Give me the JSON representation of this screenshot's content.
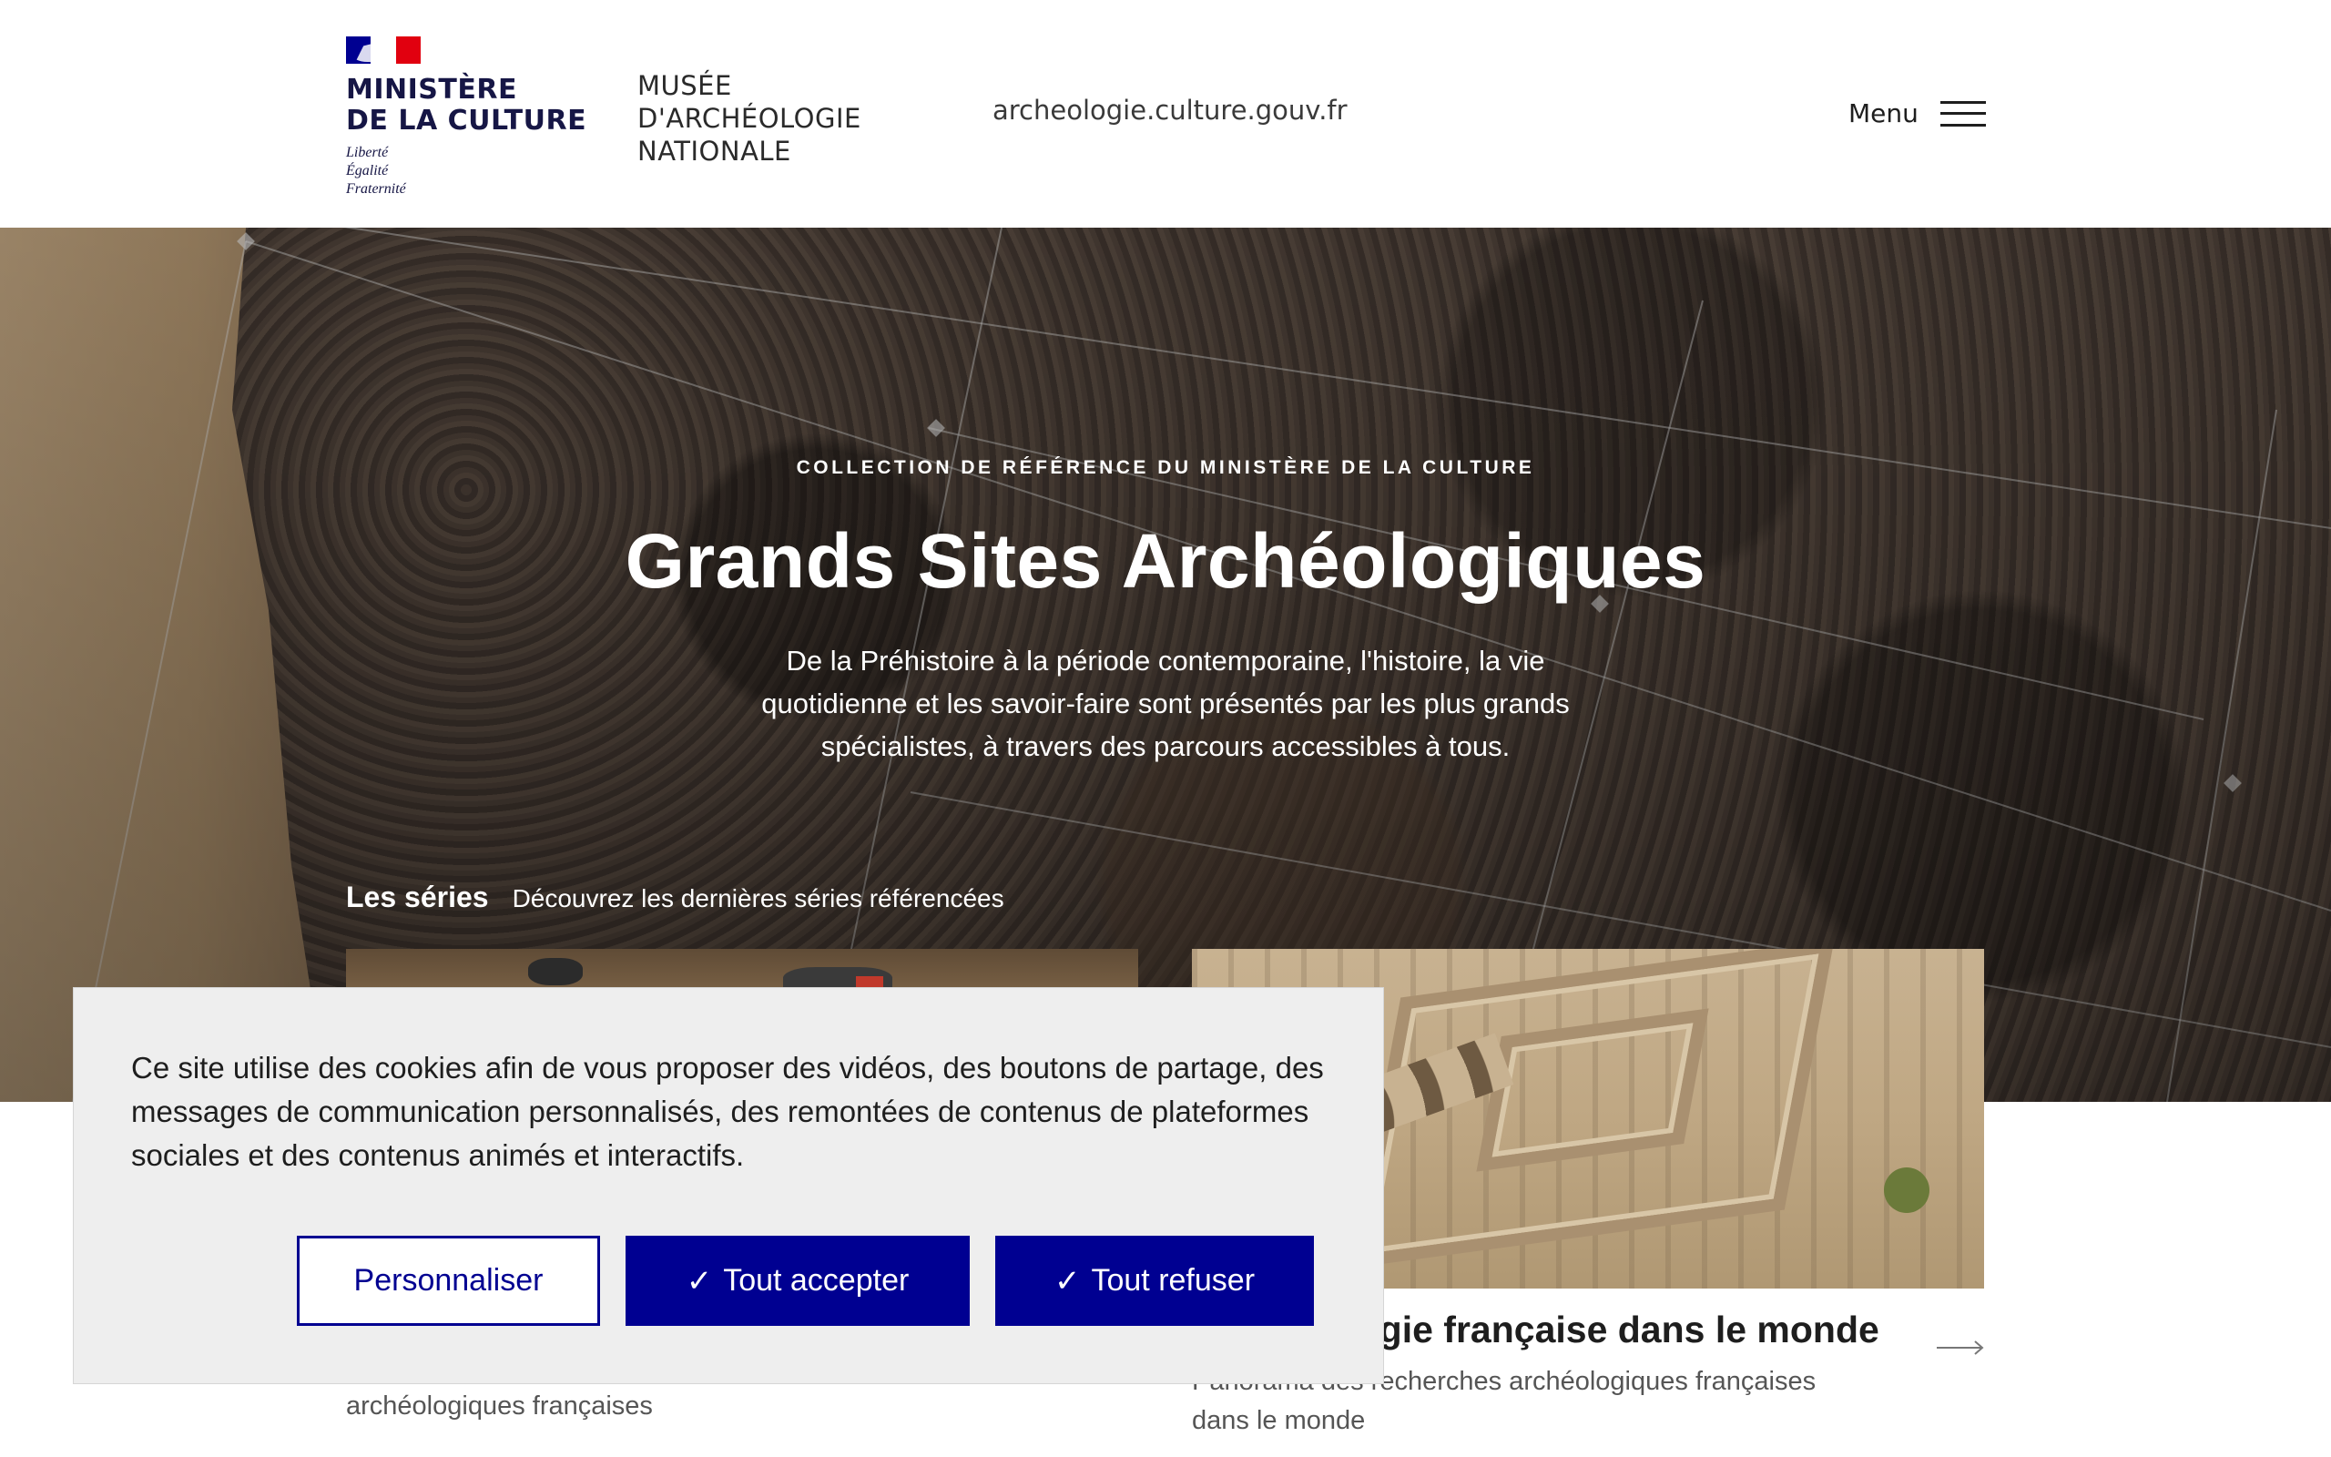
{
  "header": {
    "gov_logo": {
      "name_line1": "MINISTÈRE",
      "name_line2": "DE LA CULTURE",
      "motto": [
        "Liberté",
        "Égalité",
        "Fraternité"
      ]
    },
    "museum_logo": [
      "MUSÉE",
      "D'ARCHÉOLOGIE",
      "NATIONALE"
    ],
    "site_url": "archeologie.culture.gouv.fr",
    "menu_label": "Menu"
  },
  "hero": {
    "eyebrow": "COLLECTION DE RÉFÉRENCE DU MINISTÈRE DE LA CULTURE",
    "title": "Grands Sites Archéologiques",
    "description": "De la Préhistoire à la période contemporaine, l'histoire, la vie quotidienne et les savoir-faire sont présentés par les plus grands spécialistes, à travers des parcours accessibles à tous."
  },
  "series": {
    "title": "Les séries",
    "subtitle": "Découvrez les dernières séries référencées"
  },
  "cards": [
    {
      "title": "",
      "description": "De la grotte Chauvet, à l'archéologie de la Grande Guerre, venez découvrir le résultat des recherches archéologiques françaises"
    },
    {
      "title": "L'archéologie française dans le monde",
      "description": "Panorama des recherches archéologiques françaises dans le monde"
    }
  ],
  "cookie_banner": {
    "text": "Ce site utilise des cookies afin de vous proposer des vidéos, des boutons de partage, des messages de communication personnalisés, des remontées de contenus de plateformes sociales et des contenus animés et interactifs.",
    "customize_label": "Personnaliser",
    "accept_label": "Tout accepter",
    "refuse_label": "Tout refuser",
    "check_glyph": "✓"
  },
  "colors": {
    "brand_blue": "#000091",
    "marianne_red": "#e1000f",
    "banner_bg": "#eeeeee"
  },
  "icons": [
    "hamburger-icon",
    "arrow-right-icon",
    "check-icon"
  ]
}
